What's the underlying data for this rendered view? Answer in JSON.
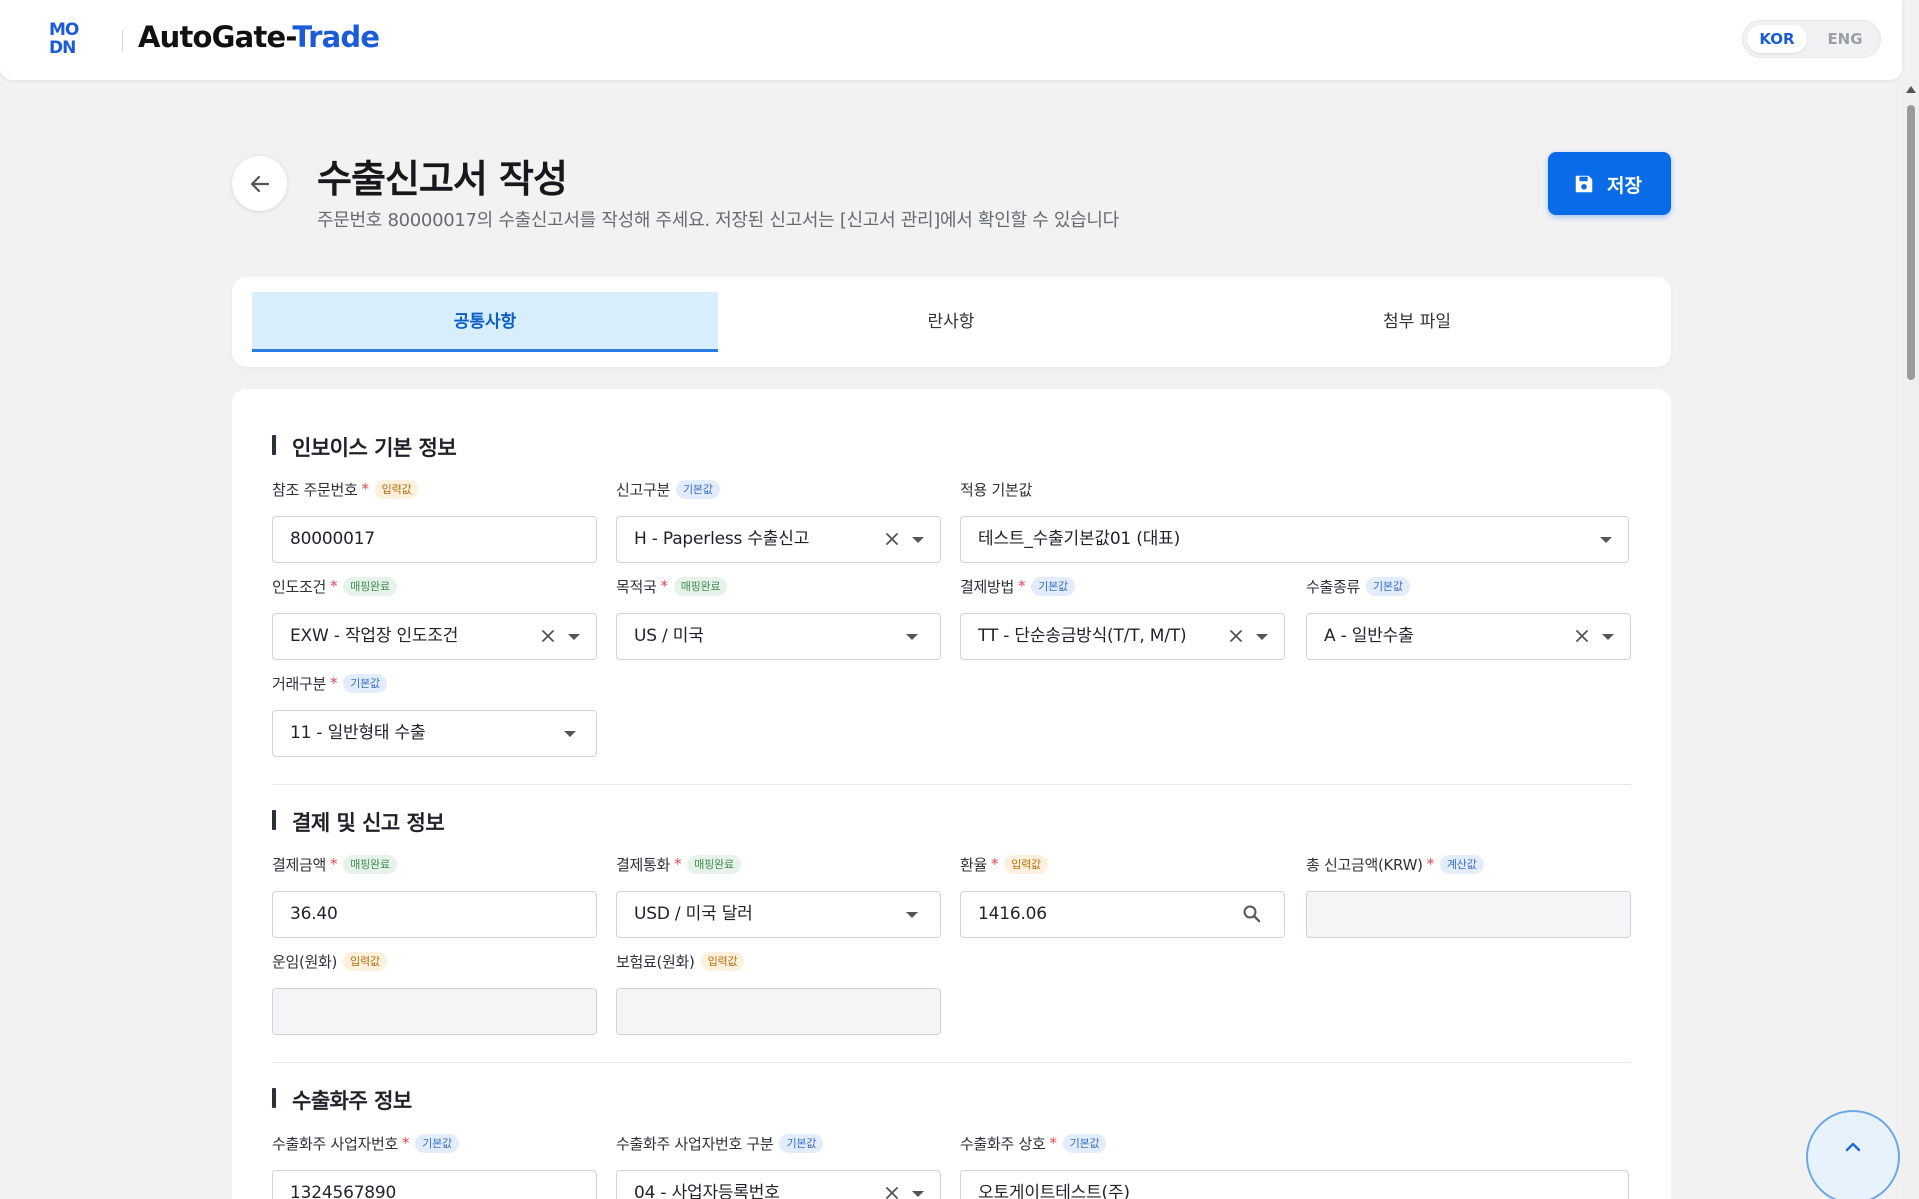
{
  "header": {
    "logo_text_top": "MO",
    "logo_text_bottom": "DN",
    "brand_main": "AutoGate-",
    "brand_accent": "Trade",
    "lang_kor": "KOR",
    "lang_eng": "ENG"
  },
  "page": {
    "title": "수출신고서 작성",
    "description": "주문번호 80000017의 수출신고서를 작성해 주세요. 저장된 신고서는 [신고서 관리]에서 확인할 수 있습니다",
    "save_label": "저장"
  },
  "tabs": [
    {
      "label": "공통사항",
      "active": true
    },
    {
      "label": "란사항",
      "active": false
    },
    {
      "label": "첨부 파일",
      "active": false
    }
  ],
  "sections": {
    "invoice": {
      "title": "인보이스 기본 정보",
      "ref_order": {
        "label": "참조 주문번호",
        "badge": "입력값",
        "value": "80000017"
      },
      "report_type": {
        "label": "신고구분",
        "badge": "기본값",
        "value": "H - Paperless 수출신고"
      },
      "applied_default": {
        "label": "적용 기본값",
        "value": "테스트_수출기본값01 (대표)"
      },
      "incoterms": {
        "label": "인도조건",
        "badge": "매핑완료",
        "value": "EXW - 작업장 인도조건"
      },
      "destination": {
        "label": "목적국",
        "badge": "매핑완료",
        "value": "US / 미국"
      },
      "payment_method": {
        "label": "결제방법",
        "badge": "기본값",
        "value": "TT - 단순송금방식(T/T, M/T)"
      },
      "export_type": {
        "label": "수출종류",
        "badge": "기본값",
        "value": "A - 일반수출"
      },
      "trade_type": {
        "label": "거래구분",
        "badge": "기본값",
        "value": "11 - 일반형태 수출"
      }
    },
    "payment": {
      "title": "결제 및 신고 정보",
      "amount": {
        "label": "결제금액",
        "badge": "매핑완료",
        "value": "36.40"
      },
      "currency": {
        "label": "결제통화",
        "badge": "매핑완료",
        "value": "USD / 미국 달러"
      },
      "exchange_rate": {
        "label": "환율",
        "badge": "입력값",
        "value": "1416.06"
      },
      "total_krw": {
        "label": "총 신고금액(KRW)",
        "badge": "계산값",
        "value": ""
      },
      "freight": {
        "label": "운임(원화)",
        "badge": "입력값",
        "value": ""
      },
      "insurance": {
        "label": "보험료(원화)",
        "badge": "입력값",
        "value": ""
      }
    },
    "shipper": {
      "title": "수출화주 정보",
      "biz_no": {
        "label": "수출화주 사업자번호",
        "badge": "기본값",
        "value": "1324567890"
      },
      "biz_no_type": {
        "label": "수출화주 사업자번호 구분",
        "badge": "기본값",
        "value": "04 - 사업자등록번호"
      },
      "company": {
        "label": "수출화주 상호",
        "badge": "기본값",
        "value": "오토게이트테스트(주)"
      }
    }
  },
  "required_mark": "*"
}
